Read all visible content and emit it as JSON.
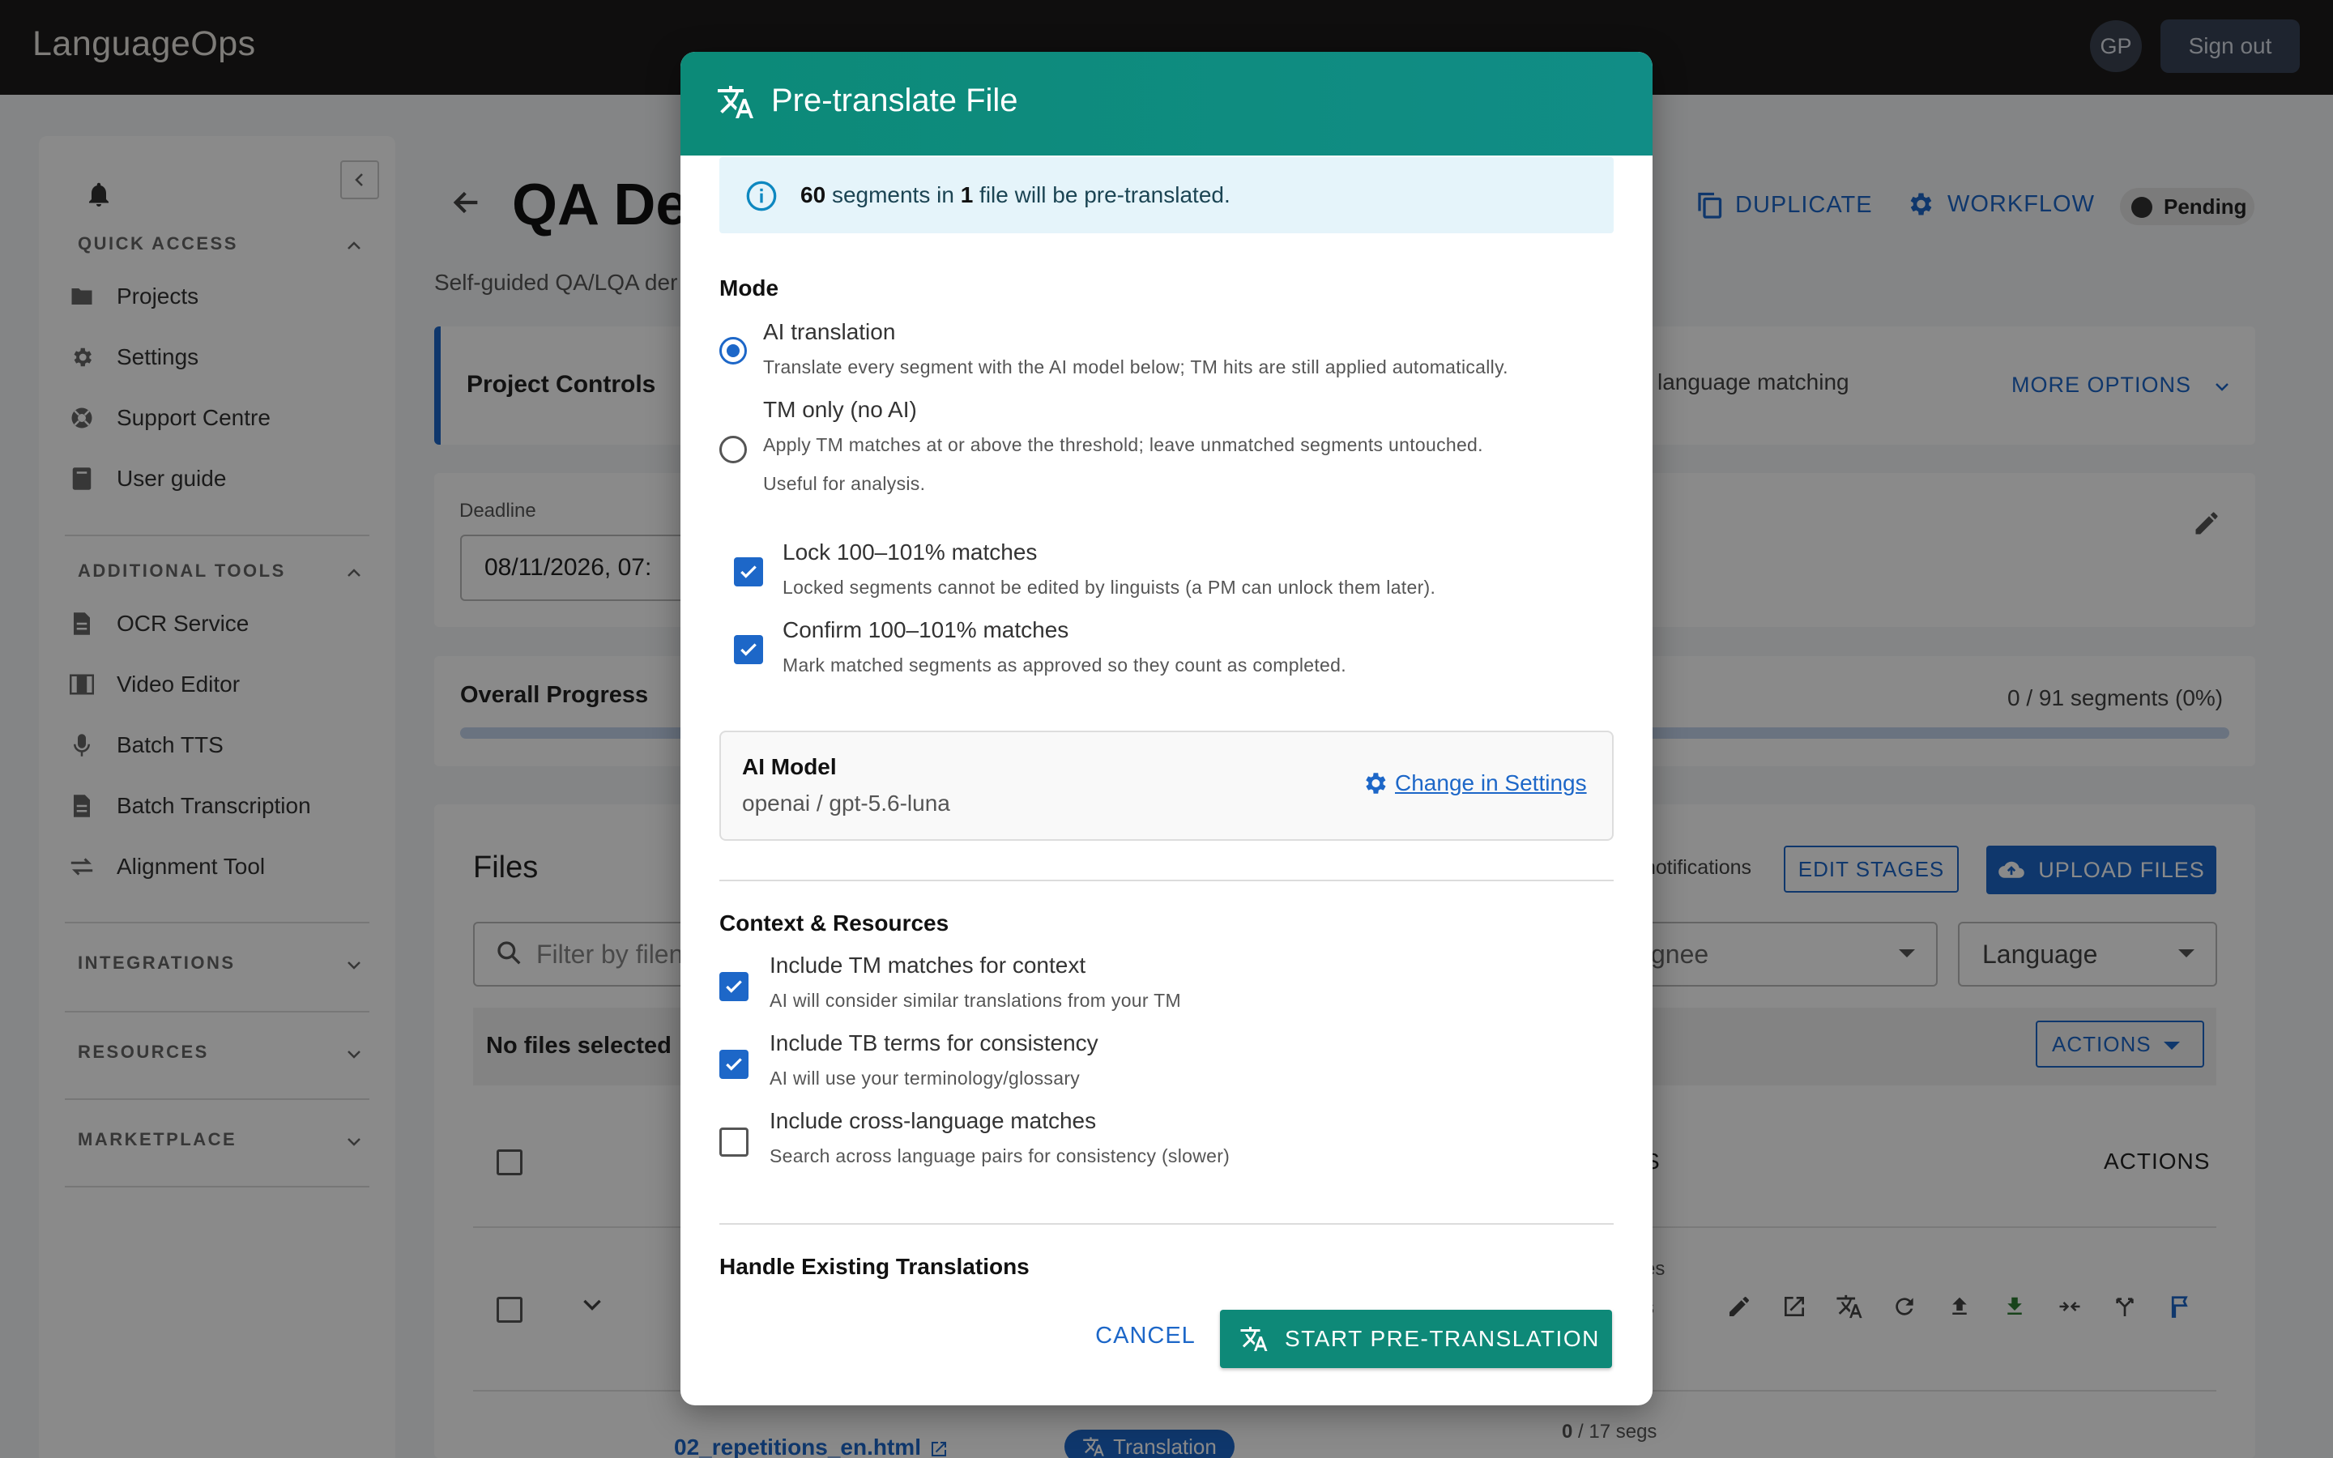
{
  "app": {
    "brand": "LanguageOps",
    "avatar_initials": "GP",
    "sign_out": "Sign out"
  },
  "sidebar": {
    "quick_access": "QUICK ACCESS",
    "quick_items": [
      {
        "label": "Projects",
        "icon": "folder-icon"
      },
      {
        "label": "Settings",
        "icon": "gear-icon"
      },
      {
        "label": "Support Centre",
        "icon": "support-icon"
      },
      {
        "label": "User guide",
        "icon": "book-icon"
      }
    ],
    "additional_tools": "ADDITIONAL TOOLS",
    "tool_items": [
      {
        "label": "OCR Service",
        "icon": "document-icon"
      },
      {
        "label": "Video Editor",
        "icon": "film-icon"
      },
      {
        "label": "Batch TTS",
        "icon": "microphone-icon"
      },
      {
        "label": "Batch Transcription",
        "icon": "document-icon"
      },
      {
        "label": "Alignment Tool",
        "icon": "swap-icon"
      }
    ],
    "integrations": "INTEGRATIONS",
    "resources": "RESOURCES",
    "marketplace": "MARKETPLACE"
  },
  "project": {
    "title": "QA De",
    "subtitle": "Self-guided QA/LQA der",
    "duplicate": "DUPLICATE",
    "workflow": "WORKFLOW",
    "status": "Pending",
    "controls_title": "Project Controls",
    "language_matching": "language matching",
    "more_options": "MORE OPTIONS",
    "deadline_label": "Deadline",
    "deadline_value": "08/11/2026, 07:",
    "overall_progress": "Overall Progress",
    "progress_count": "0 / 91 segments (0%)",
    "progress_fraction": 0
  },
  "files": {
    "title": "Files",
    "notifications": "notifications",
    "edit_stages": "EDIT STAGES",
    "upload_files": "UPLOAD FILES",
    "filter_placeholder": "Filter by filen",
    "assignee": "gnee",
    "language": "Language",
    "no_files_selected": "No files selected",
    "actions": "ACTIONS",
    "col_s": "S",
    "col_actions": "ACTIONS",
    "row2_name": "02_repetitions_en.html",
    "row2_badge": "Translation",
    "row2_segs_num": "0",
    "row2_segs_rest": "/ 17 segs",
    "row1_frag1": "es",
    "row1_frag2": "s",
    "row1_frag3": "%"
  },
  "modal": {
    "title": "Pre-translate File",
    "info_count": "60",
    "info_mid": "segments in",
    "info_files": "1",
    "info_tail": "file will be pre-translated.",
    "mode_heading": "Mode",
    "mode_ai_title": "AI translation",
    "mode_ai_desc": "Translate every segment with the AI model below; TM hits are still applied automatically.",
    "mode_tm_title": "TM only (no AI)",
    "mode_tm_desc1": "Apply TM matches at or above the threshold; leave unmatched segments untouched.",
    "mode_tm_desc2": "Useful for analysis.",
    "mode_selected": "AI translation",
    "lock_title": "Lock 100–101% matches",
    "lock_desc": "Locked segments cannot be edited by linguists (a PM can unlock them later).",
    "confirm_title": "Confirm 100–101% matches",
    "confirm_desc": "Mark matched segments as approved so they count as completed.",
    "model_label": "AI Model",
    "model_value": "openai / gpt-5.6-luna",
    "change_settings": "Change in Settings",
    "context_heading": "Context & Resources",
    "tm_title": "Include TM matches for context",
    "tm_desc": "AI will consider similar translations from your TM",
    "tb_title": "Include TB terms for consistency",
    "tb_desc": "AI will use your terminology/glossary",
    "cross_title": "Include cross-language matches",
    "cross_desc": "Search across language pairs for consistency (slower)",
    "existing_heading": "Handle Existing Translations",
    "cancel": "CANCEL",
    "start": "START PRE-TRANSLATION"
  }
}
